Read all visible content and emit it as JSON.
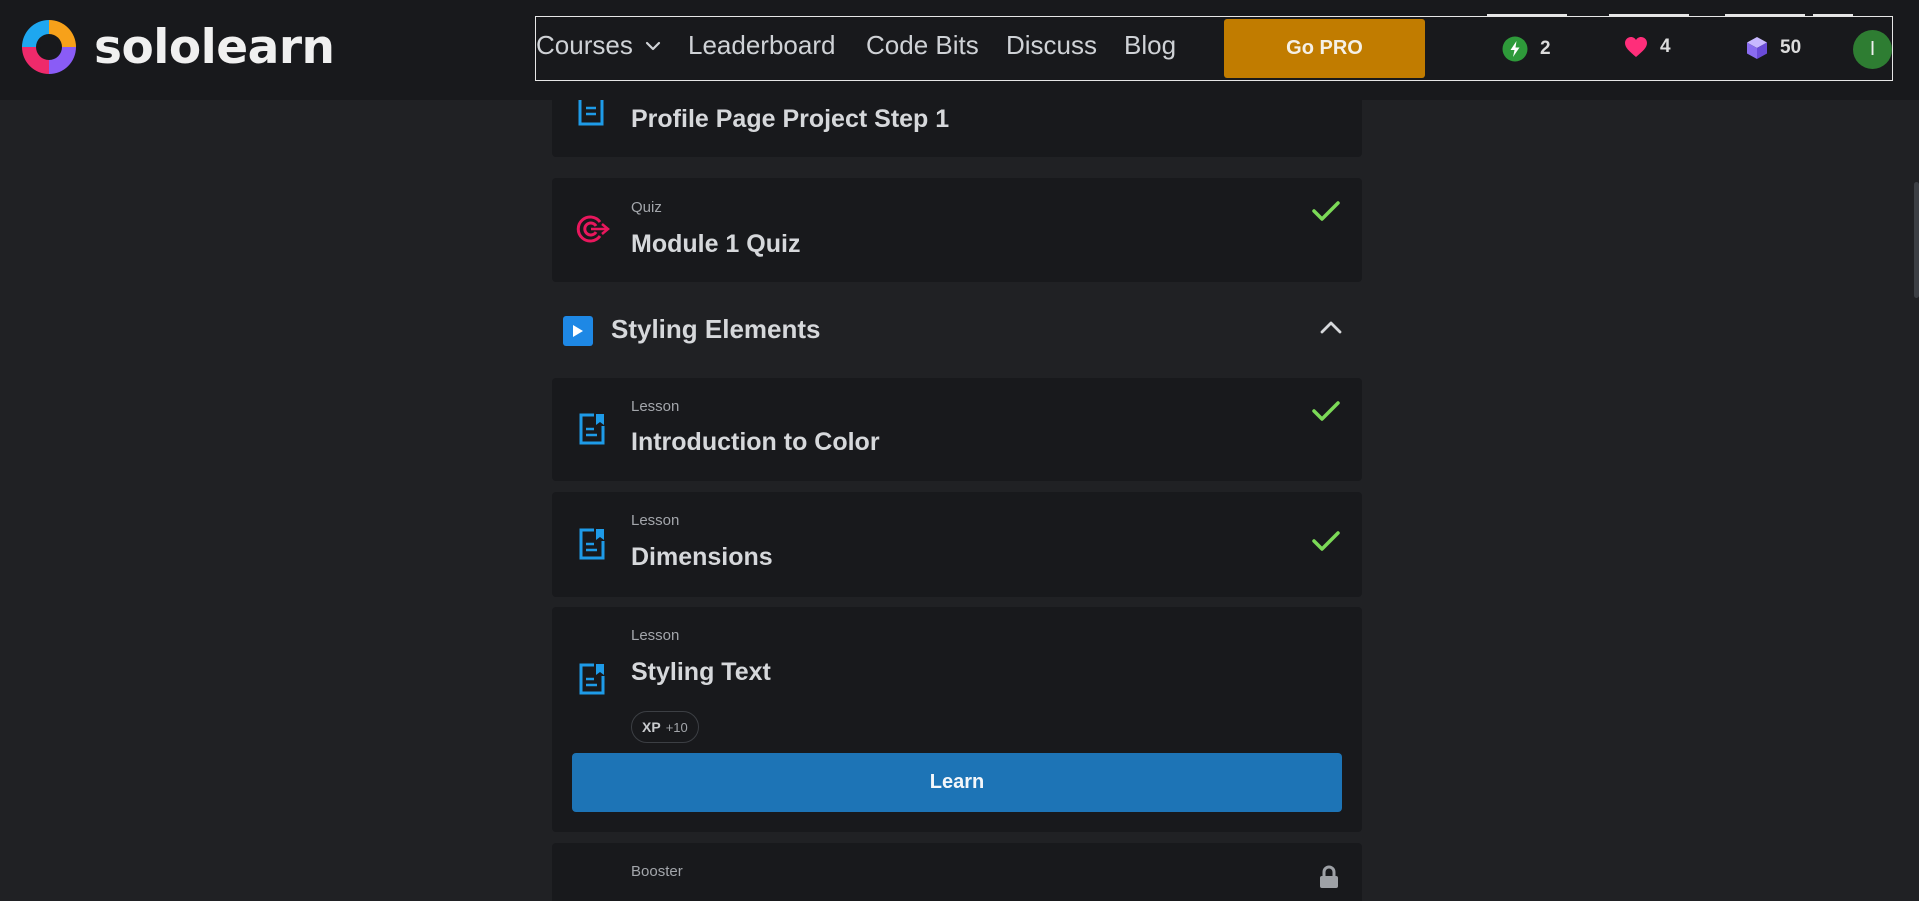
{
  "app": {
    "logo_text": "sololearn"
  },
  "nav": {
    "courses": "Courses",
    "leaderboard": "Leaderboard",
    "code_bits": "Code Bits",
    "discuss": "Discuss",
    "blog": "Blog",
    "go_pro": "Go PRO"
  },
  "stats": {
    "streak": "2",
    "hearts": "4",
    "gems": "50"
  },
  "user": {
    "avatar_initial": "I"
  },
  "lessons": {
    "profile_project": {
      "title": "Profile Page Project Step 1"
    },
    "module_quiz": {
      "type": "Quiz",
      "title": "Module 1 Quiz",
      "completed": true
    },
    "section": {
      "title": "Styling Elements",
      "expanded": true
    },
    "intro_color": {
      "type": "Lesson",
      "title": "Introduction to Color",
      "completed": true
    },
    "dimensions": {
      "type": "Lesson",
      "title": "Dimensions",
      "completed": true
    },
    "styling_text": {
      "type": "Lesson",
      "title": "Styling Text",
      "xp_label": "XP",
      "xp_value": "+10",
      "button": "Learn"
    },
    "booster": {
      "type": "Booster",
      "locked": true
    }
  },
  "colors": {
    "accent_blue": "#1d74b6",
    "pro_orange": "#c17c00",
    "check_green": "#7bd957",
    "quiz_red": "#e8175d",
    "heart_pink": "#ff2e7a"
  },
  "icons": {
    "lesson": "lesson-doc-icon",
    "quiz": "target-icon",
    "check": "check-icon",
    "lock": "lock-icon",
    "streak": "bolt-icon",
    "hearts": "heart-icon",
    "gems": "gem-icon"
  }
}
